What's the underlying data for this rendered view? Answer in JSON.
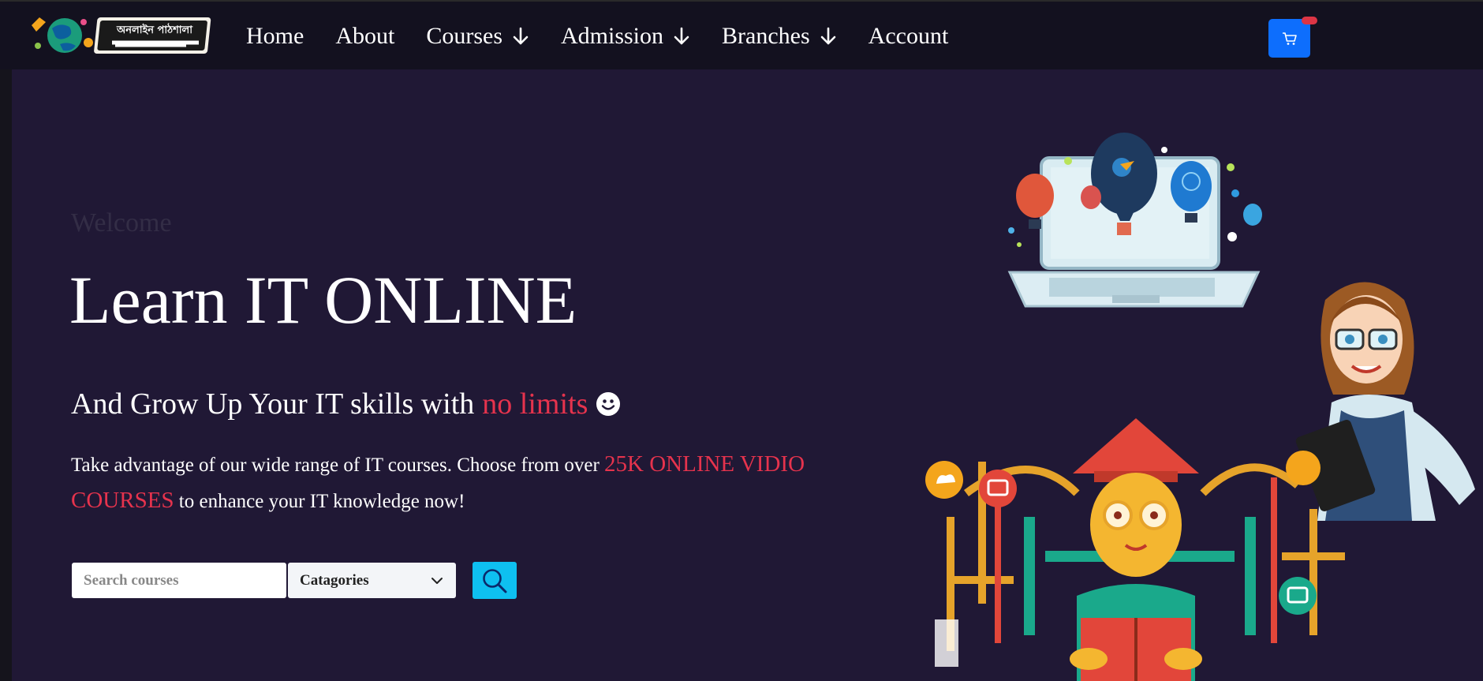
{
  "nav": {
    "logo_text": "অনলাইন পাঠশালা",
    "items": [
      {
        "label": "Home",
        "dropdown": false
      },
      {
        "label": "About",
        "dropdown": false
      },
      {
        "label": "Courses",
        "dropdown": true
      },
      {
        "label": "Admission",
        "dropdown": true
      },
      {
        "label": "Branches",
        "dropdown": true
      },
      {
        "label": "Account",
        "dropdown": false
      }
    ],
    "cart_icon": "cart-icon"
  },
  "hero": {
    "welcome": "Welcome",
    "headline": "Learn IT ONLINE",
    "subline_prefix": "And Grow Up Your IT skills with",
    "subline_accent": "no limits",
    "desc_prefix": "Take advantage of our wide range of IT courses. Choose from over",
    "desc_accent": "25K ONLINE VIDIO COURSES",
    "desc_suffix": "to enhance your IT knowledge now!"
  },
  "search": {
    "placeholder": "Search courses",
    "category_selected": "Catagories"
  },
  "colors": {
    "nav_bg": "#13111f",
    "hero_bg": "#201835",
    "accent_red": "#e6334d",
    "cart_blue": "#0d6efd",
    "search_btn": "#0ec0f0"
  }
}
